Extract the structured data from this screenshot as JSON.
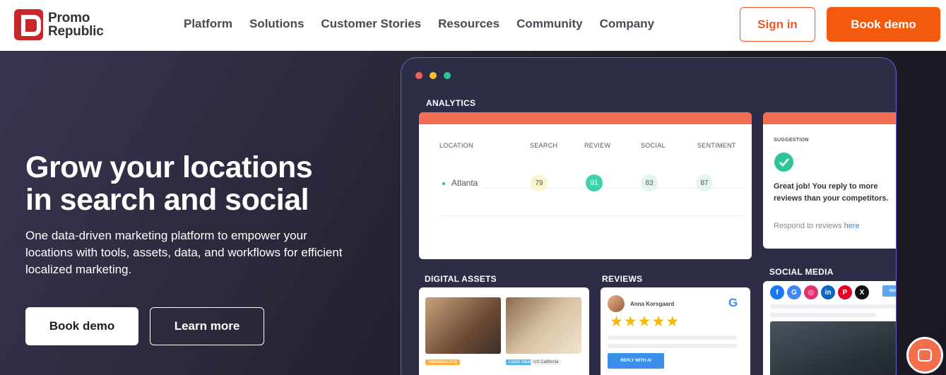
{
  "brand": {
    "line1": "Promo",
    "line2": "Republic",
    "color": "#c8262b",
    "accent": "#f45a0e"
  },
  "nav": [
    "Platform",
    "Solutions",
    "Customer Stories",
    "Resources",
    "Community",
    "Company"
  ],
  "header_buttons": {
    "signin": "Sign in",
    "book_demo": "Book demo"
  },
  "hero": {
    "title_line1": "Grow your locations",
    "title_line2": "in search and social",
    "subtitle": "One data-driven marketing platform to empower your locations with tools, assets, data, and workflows for efficient localized marketing.",
    "btn_book": "Book demo",
    "btn_learn": "Learn more"
  },
  "mock": {
    "analytics_label": "ANALYTICS",
    "columns": [
      "LOCATION",
      "SEARCH",
      "REVIEW",
      "SOCIAL",
      "SENTIMENT"
    ],
    "row": {
      "location": "Atlanta",
      "search": "79",
      "review": "91",
      "social": "83",
      "sentiment": "87"
    },
    "suggestion": {
      "label": "SUGGESTION",
      "text": "Great job! You reply to more reviews than your competitors.",
      "link_prefix": "Respond to reviews",
      "link": "here"
    },
    "digital_assets_label": "DIGITAL ASSETS",
    "reviews_label": "REVIEWS",
    "social_label": "SOCIAL MEDIA",
    "asset_tags": [
      "Valentine's Day",
      "Lunch Ideas",
      "US California"
    ],
    "reviewer": "Anna Korsgaard",
    "stars": "★★★★★",
    "reply_ai": "REPLY WITH AI",
    "send_post": "SEND POST"
  }
}
